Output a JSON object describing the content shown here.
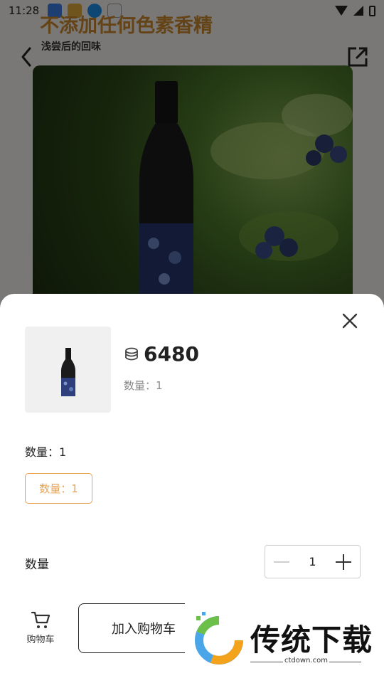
{
  "status_bar": {
    "time": "11:28"
  },
  "background": {
    "title": "不添加任何色素香精",
    "subtitle": "浅尝后的回味"
  },
  "sheet": {
    "price": "6480",
    "quantity_summary": "数量：1",
    "spec": {
      "label": "数量：1",
      "option": "数量：1"
    },
    "quantity": {
      "label": "数量",
      "value": "1"
    },
    "cart_tab_label": "购物车",
    "add_to_cart_label": "加入购物车"
  },
  "watermark": {
    "brand": "传统下载",
    "url": "ctdown.com"
  },
  "colors": {
    "accent": "#e9a253",
    "title_orange": "#c8862f",
    "overlay": "rgba(0,0,0,0.5)"
  },
  "icons": [
    "back-arrow-icon",
    "share-icon",
    "close-icon",
    "coin-icon",
    "minus-icon",
    "plus-icon",
    "cart-icon",
    "wifi-icon",
    "signal-icon",
    "battery-icon"
  ]
}
